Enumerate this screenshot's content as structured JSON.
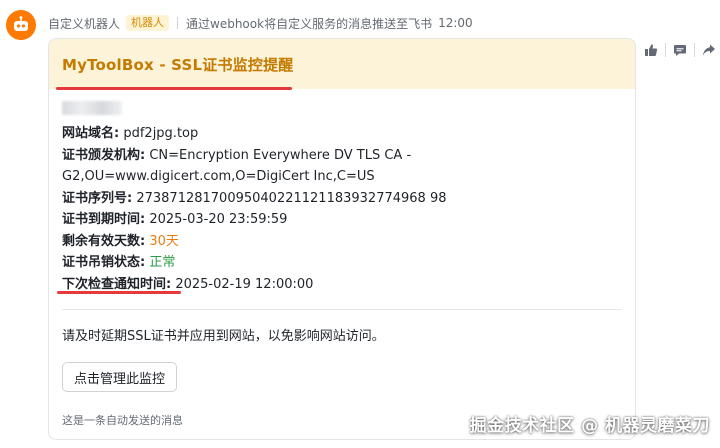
{
  "sender": {
    "name": "自定义机器人",
    "badge": "机器人",
    "description": "通过webhook将自定义服务的消息推送至飞书",
    "time": "12:00"
  },
  "card": {
    "title": "MyToolBox - SSL证书监控提醒",
    "rows": {
      "domain": {
        "label": "网站域名:",
        "value": "pdf2jpg.top"
      },
      "issuer": {
        "label": "证书颁发机构:",
        "value": "CN=Encryption Everywhere DV TLS CA - G2,OU=www.digicert.com,O=DigiCert Inc,C=US"
      },
      "serial": {
        "label": "证书序列号:",
        "value": "27387128170095040221121183932774968 98"
      },
      "expiry": {
        "label": "证书到期时间:",
        "value": "2025-03-20 23:59:59"
      },
      "remaining": {
        "label": "剩余有效天数:",
        "value": "30天"
      },
      "revocation": {
        "label": "证书吊销状态:",
        "value": "正常"
      },
      "next_check": {
        "label": "下次检查通知时间:",
        "value": "2025-02-19 12:00:00"
      }
    },
    "notice": "请及时延期SSL证书并应用到网站，以免影响网站访问。",
    "button": "点击管理此监控",
    "footer": "这是一条自动发送的消息"
  },
  "toolbar": {
    "icons": [
      "thumbs-up-icon",
      "comment-icon",
      "share-icon"
    ]
  },
  "watermark": "掘金技术社区 @ 机器灵磨菜刀",
  "colors": {
    "accent_orange": "#ff7a00",
    "title_gold": "#c57a00",
    "header_bg": "#fcf3d9",
    "highlight_red": "#e5393b",
    "warn": "#e87d14",
    "ok": "#2d9a46"
  }
}
